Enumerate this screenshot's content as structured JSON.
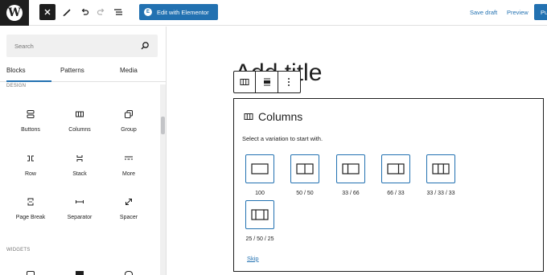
{
  "header": {
    "logo_letter": "W",
    "elementor_label": "Edit with Elementor",
    "elementor_icon": "E",
    "save_draft": "Save draft",
    "preview": "Preview",
    "publish": "Pu"
  },
  "inserter": {
    "search_placeholder": "Search",
    "tabs": [
      "Blocks",
      "Patterns",
      "Media"
    ],
    "active_tab": "Blocks",
    "sections": {
      "design": "DESIGN",
      "widgets": "WIDGETS"
    },
    "blocks": [
      {
        "label": "Buttons",
        "icon": "buttons-icon"
      },
      {
        "label": "Columns",
        "icon": "columns-icon"
      },
      {
        "label": "Group",
        "icon": "group-icon"
      },
      {
        "label": "Row",
        "icon": "row-icon"
      },
      {
        "label": "Stack",
        "icon": "stack-icon"
      },
      {
        "label": "More",
        "icon": "more-icon"
      },
      {
        "label": "Page Break",
        "icon": "page-break-icon"
      },
      {
        "label": "Separator",
        "icon": "separator-icon"
      },
      {
        "label": "Spacer",
        "icon": "spacer-icon"
      }
    ]
  },
  "editor": {
    "title_placeholder": "Add title",
    "placeholder": {
      "title": "Columns",
      "description": "Select a variation to start with.",
      "variations": [
        "100",
        "50 / 50",
        "33 / 66",
        "66 / 33",
        "33 / 33 / 33",
        "25 / 50 / 25"
      ],
      "skip": "Skip"
    }
  },
  "colors": {
    "accent": "#2271b1",
    "dark": "#1e1e1e"
  }
}
